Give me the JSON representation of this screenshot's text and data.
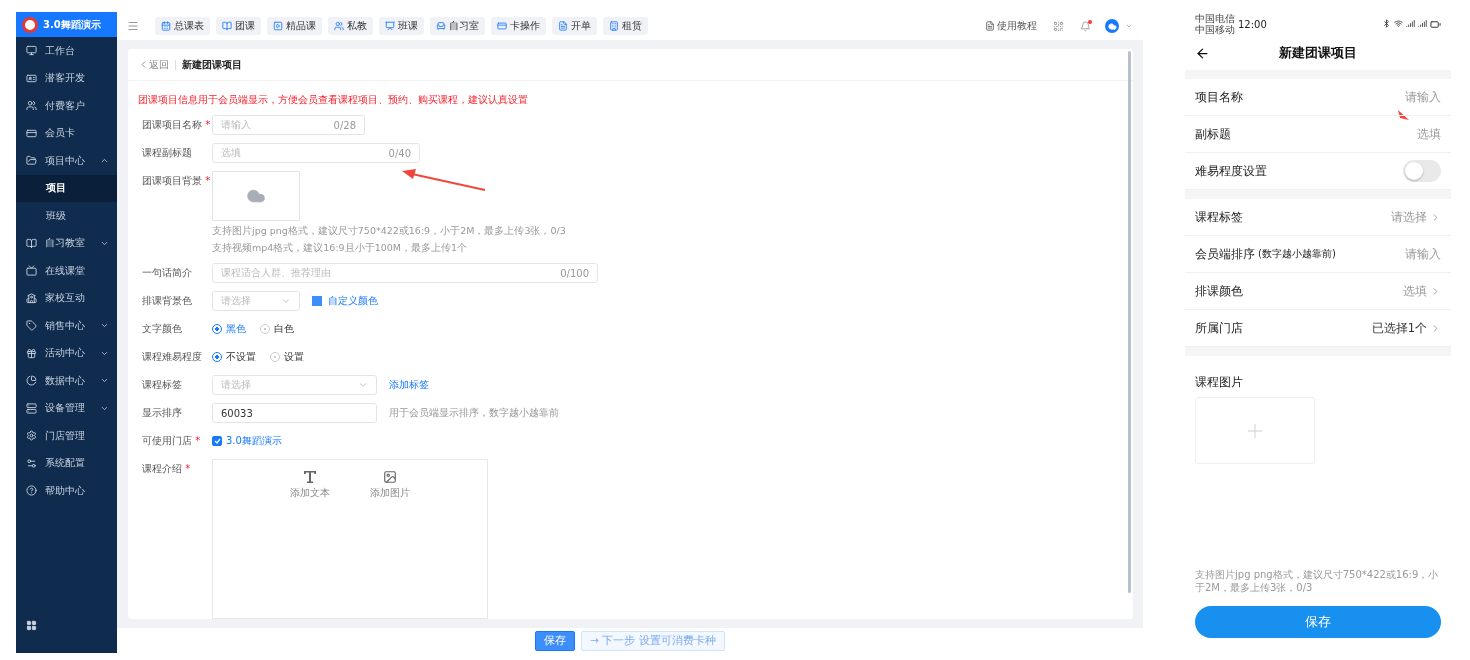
{
  "app": {
    "brand": "3.0舞蹈演示"
  },
  "sidebar": {
    "items": [
      {
        "label": "工作台",
        "kind": "link",
        "selected": false
      },
      {
        "label": "潜客开发",
        "kind": "link",
        "selected": false
      },
      {
        "label": "付费客户",
        "kind": "link",
        "selected": false
      },
      {
        "label": "会员卡",
        "kind": "link",
        "selected": false
      },
      {
        "label": "项目中心",
        "kind": "menu",
        "expanded": true,
        "selected": false,
        "children": [
          {
            "label": "项目",
            "selected": true
          },
          {
            "label": "班级",
            "selected": false
          }
        ]
      },
      {
        "label": "自习教室",
        "kind": "menu",
        "expanded": false,
        "selected": false
      },
      {
        "label": "在线课堂",
        "kind": "link",
        "selected": false
      },
      {
        "label": "家校互动",
        "kind": "link",
        "selected": false
      },
      {
        "label": "销售中心",
        "kind": "menu",
        "expanded": false,
        "selected": false
      },
      {
        "label": "活动中心",
        "kind": "menu",
        "expanded": false,
        "selected": false
      },
      {
        "label": "数据中心",
        "kind": "menu",
        "expanded": false,
        "selected": false
      },
      {
        "label": "设备管理",
        "kind": "menu",
        "expanded": false,
        "selected": false
      },
      {
        "label": "门店管理",
        "kind": "link",
        "selected": false
      },
      {
        "label": "系统配置",
        "kind": "link",
        "selected": false
      },
      {
        "label": "帮助中心",
        "kind": "link",
        "selected": false
      }
    ]
  },
  "top_tabs": [
    "总课表",
    "团课",
    "精品课",
    "私教",
    "班课",
    "自习室",
    "卡操作",
    "开单",
    "租赁"
  ],
  "header": {
    "tutorial": "使用教程",
    "notification_dot": true
  },
  "page": {
    "back": "返回",
    "title": "新建团课项目",
    "notice": "团课项目信息用于会员端显示，方便会员查看课程项目、预约、购买课程，建议认真设置",
    "fields": [
      {
        "kind": "text",
        "label": "团课项目名称",
        "required_mark": "*",
        "placeholder": "请输入",
        "counter": "0/28"
      },
      {
        "kind": "text",
        "label": "课程副标题",
        "placeholder": "选填",
        "counter": "0/40"
      },
      {
        "kind": "upload",
        "label": "团课项目背景",
        "required_mark": "*",
        "hints": [
          "支持图片jpg png格式，建议尺寸750*422或16:9，小于2M，最多上传3张，0/3",
          "支持视频mp4格式，建议16:9且小于100M，最多上传1个"
        ]
      },
      {
        "kind": "text",
        "label": "一句话简介",
        "placeholder": "课程适合人群、推荐理由",
        "counter": "0/100"
      },
      {
        "kind": "color_select",
        "label": "排课背景色",
        "placeholder": "请选择",
        "link": "自定义颜色"
      },
      {
        "kind": "radio",
        "label": "文字颜色",
        "options": [
          {
            "label": "黑色",
            "selected": true
          },
          {
            "label": "白色",
            "selected": false
          }
        ]
      },
      {
        "kind": "radio",
        "label": "课程难易程度",
        "options": [
          {
            "label": "不设置",
            "selected": true
          },
          {
            "label": "设置",
            "selected": false
          }
        ]
      },
      {
        "kind": "select",
        "label": "课程标签",
        "placeholder": "请选择",
        "link": "添加标签"
      },
      {
        "kind": "value",
        "label": "显示排序",
        "value": "60033",
        "hint": "用于会员端显示排序，数字越小越靠前"
      },
      {
        "kind": "checkbox",
        "label": "可使用门店",
        "required_mark": "*",
        "option": "3.0舞蹈演示",
        "checked": true
      },
      {
        "kind": "editor",
        "label": "课程介绍",
        "required_mark": "*",
        "tools": [
          "添加文本",
          "添加图片"
        ]
      }
    ]
  },
  "footer": {
    "buttons": [
      {
        "label": "保存",
        "kind": "primary"
      },
      {
        "label": "→ 下一步 设置可消费卡种",
        "kind": "secondary"
      }
    ]
  },
  "phone": {
    "status": {
      "carrier_1": "中国电信",
      "carrier_2": "中国移动",
      "time": "12:00"
    },
    "title": "新建团课项目",
    "groups": [
      [
        {
          "kind": "input",
          "label": "项目名称",
          "value": "请输入"
        },
        {
          "kind": "input",
          "label": "副标题",
          "value": "选填"
        },
        {
          "kind": "toggle",
          "label": "难易程度设置",
          "on": false
        }
      ],
      [
        {
          "kind": "picker",
          "label": "课程标签",
          "value": "请选择"
        },
        {
          "kind": "input",
          "label": "会员端排序",
          "note": "(数字越小越靠前)",
          "value": "请输入"
        },
        {
          "kind": "picker",
          "label": "排课颜色",
          "value": "选填"
        },
        {
          "kind": "picker",
          "label": "所属门店",
          "value": "已选择1个",
          "strong": true
        }
      ]
    ],
    "image_label": "课程图片",
    "hint": "支持图片jpg png格式，建议尺寸750*422或16:9，小于2M，最多上传3张，0/3",
    "save": "保存"
  }
}
